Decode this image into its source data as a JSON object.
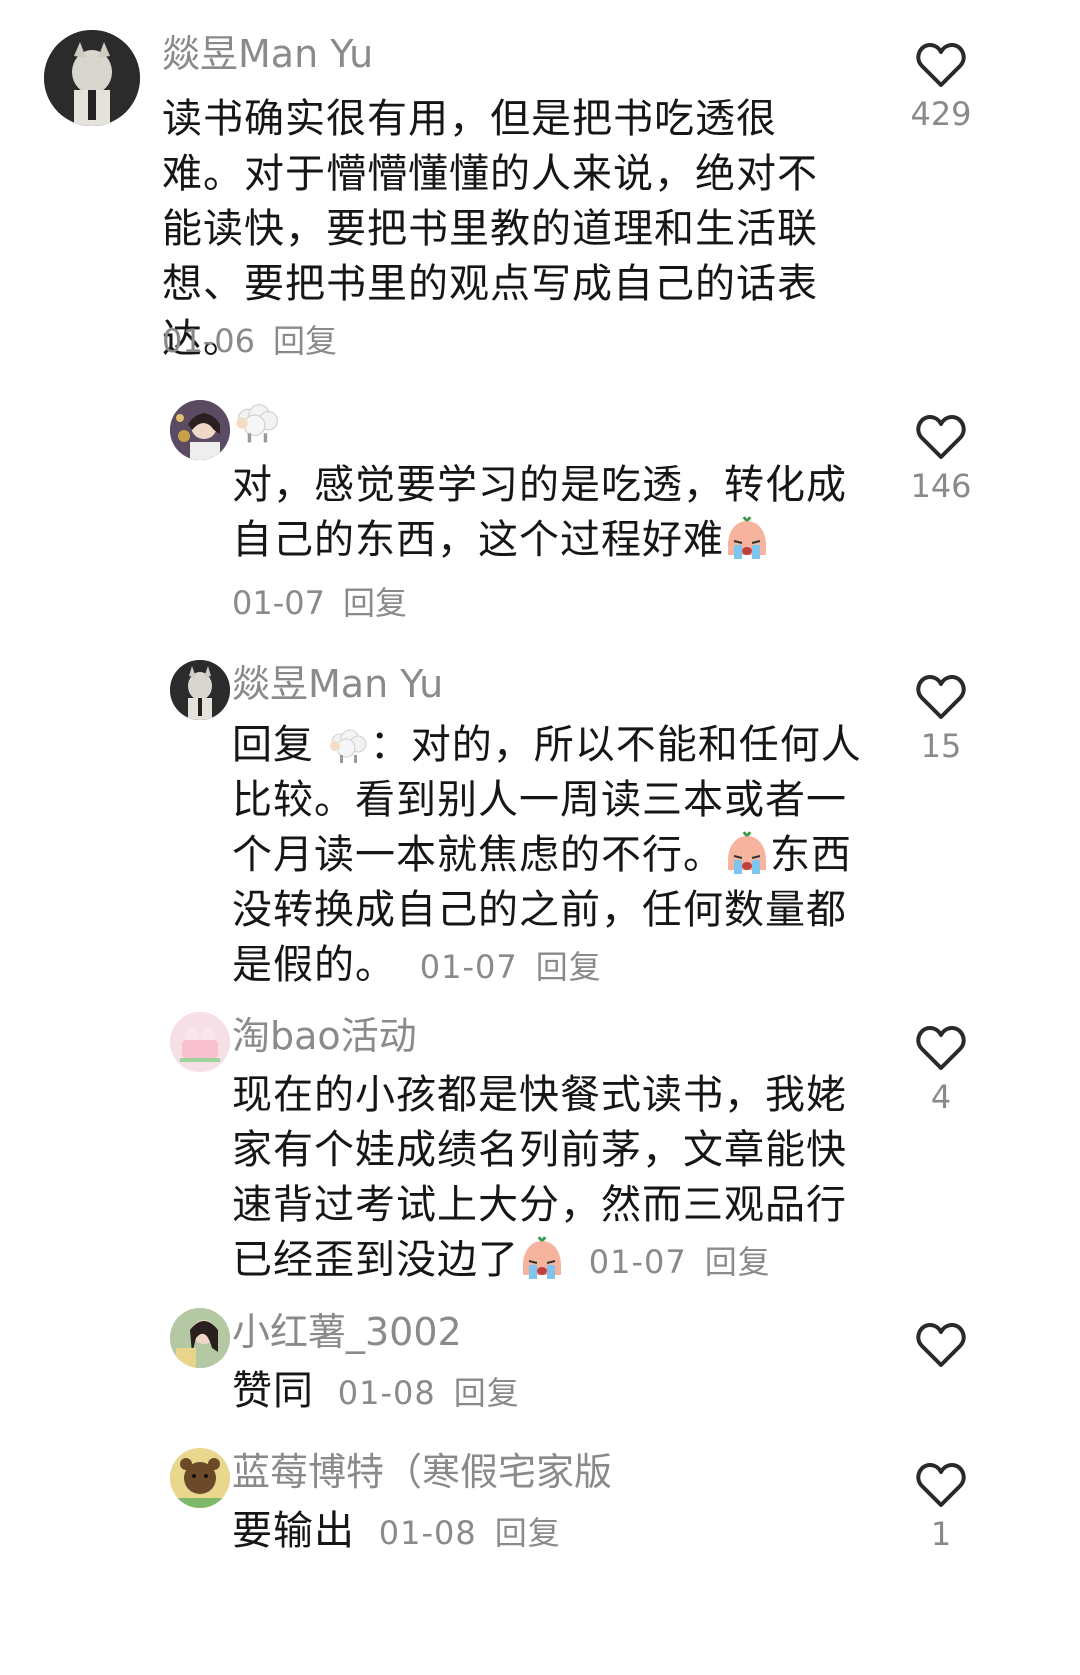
{
  "comments": [
    {
      "author": "燚昱Man Yu",
      "text": "读书确实很有用，但是把书吃透很难。对于懵懵懂懂的人来说，绝对不能读快，要把书里教的道理和生活联想、要把书里的观点写成自己的话表达。",
      "date": "01-06",
      "reply": "回复",
      "likes": "429"
    },
    {
      "author_icon": "sheep-emoji",
      "text": "对，感觉要学习的是吃透，转化成自己的东西，这个过程好难",
      "date": "01-07",
      "reply": "回复",
      "likes": "146"
    },
    {
      "author": "燚昱Man Yu",
      "reply_prefix": "回复",
      "reply_suffix": "：对的，所以不能和任何人比较。看到别人一周读三本或者一个月读一本就焦虑的不行。",
      "text_tail": "东西没转换成自己的之前，任何数量都是假的。",
      "date": "01-07",
      "reply": "回复",
      "likes": "15"
    },
    {
      "author": "淘bao活动",
      "text": "现在的小孩都是快餐式读书，我姥家有个娃成绩名列前茅，文章能快速背过考试上大分，然而三观品行已经歪到没边了",
      "date": "01-07",
      "reply": "回复",
      "likes": "4"
    },
    {
      "author": "小红薯_3002",
      "text": "赞同",
      "date": "01-08",
      "reply": "回复",
      "likes": ""
    },
    {
      "author": "蓝莓博特（寒假宅家版",
      "text": "要输出",
      "date": "01-08",
      "reply": "回复",
      "likes": "1"
    }
  ],
  "colors": {
    "meta": "#8a8a8a",
    "text": "#161616",
    "background": "#ffffff"
  }
}
